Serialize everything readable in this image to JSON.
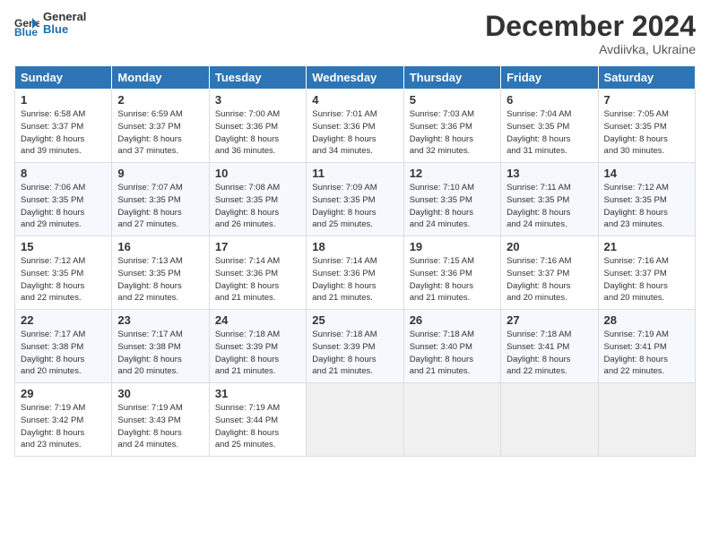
{
  "header": {
    "logo_general": "General",
    "logo_blue": "Blue",
    "month_title": "December 2024",
    "location": "Avdiivka, Ukraine"
  },
  "weekdays": [
    "Sunday",
    "Monday",
    "Tuesday",
    "Wednesday",
    "Thursday",
    "Friday",
    "Saturday"
  ],
  "weeks": [
    [
      {
        "day": "1",
        "info": "Sunrise: 6:58 AM\nSunset: 3:37 PM\nDaylight: 8 hours\nand 39 minutes."
      },
      {
        "day": "2",
        "info": "Sunrise: 6:59 AM\nSunset: 3:37 PM\nDaylight: 8 hours\nand 37 minutes."
      },
      {
        "day": "3",
        "info": "Sunrise: 7:00 AM\nSunset: 3:36 PM\nDaylight: 8 hours\nand 36 minutes."
      },
      {
        "day": "4",
        "info": "Sunrise: 7:01 AM\nSunset: 3:36 PM\nDaylight: 8 hours\nand 34 minutes."
      },
      {
        "day": "5",
        "info": "Sunrise: 7:03 AM\nSunset: 3:36 PM\nDaylight: 8 hours\nand 32 minutes."
      },
      {
        "day": "6",
        "info": "Sunrise: 7:04 AM\nSunset: 3:35 PM\nDaylight: 8 hours\nand 31 minutes."
      },
      {
        "day": "7",
        "info": "Sunrise: 7:05 AM\nSunset: 3:35 PM\nDaylight: 8 hours\nand 30 minutes."
      }
    ],
    [
      {
        "day": "8",
        "info": "Sunrise: 7:06 AM\nSunset: 3:35 PM\nDaylight: 8 hours\nand 29 minutes."
      },
      {
        "day": "9",
        "info": "Sunrise: 7:07 AM\nSunset: 3:35 PM\nDaylight: 8 hours\nand 27 minutes."
      },
      {
        "day": "10",
        "info": "Sunrise: 7:08 AM\nSunset: 3:35 PM\nDaylight: 8 hours\nand 26 minutes."
      },
      {
        "day": "11",
        "info": "Sunrise: 7:09 AM\nSunset: 3:35 PM\nDaylight: 8 hours\nand 25 minutes."
      },
      {
        "day": "12",
        "info": "Sunrise: 7:10 AM\nSunset: 3:35 PM\nDaylight: 8 hours\nand 24 minutes."
      },
      {
        "day": "13",
        "info": "Sunrise: 7:11 AM\nSunset: 3:35 PM\nDaylight: 8 hours\nand 24 minutes."
      },
      {
        "day": "14",
        "info": "Sunrise: 7:12 AM\nSunset: 3:35 PM\nDaylight: 8 hours\nand 23 minutes."
      }
    ],
    [
      {
        "day": "15",
        "info": "Sunrise: 7:12 AM\nSunset: 3:35 PM\nDaylight: 8 hours\nand 22 minutes."
      },
      {
        "day": "16",
        "info": "Sunrise: 7:13 AM\nSunset: 3:35 PM\nDaylight: 8 hours\nand 22 minutes."
      },
      {
        "day": "17",
        "info": "Sunrise: 7:14 AM\nSunset: 3:36 PM\nDaylight: 8 hours\nand 21 minutes."
      },
      {
        "day": "18",
        "info": "Sunrise: 7:14 AM\nSunset: 3:36 PM\nDaylight: 8 hours\nand 21 minutes."
      },
      {
        "day": "19",
        "info": "Sunrise: 7:15 AM\nSunset: 3:36 PM\nDaylight: 8 hours\nand 21 minutes."
      },
      {
        "day": "20",
        "info": "Sunrise: 7:16 AM\nSunset: 3:37 PM\nDaylight: 8 hours\nand 20 minutes."
      },
      {
        "day": "21",
        "info": "Sunrise: 7:16 AM\nSunset: 3:37 PM\nDaylight: 8 hours\nand 20 minutes."
      }
    ],
    [
      {
        "day": "22",
        "info": "Sunrise: 7:17 AM\nSunset: 3:38 PM\nDaylight: 8 hours\nand 20 minutes."
      },
      {
        "day": "23",
        "info": "Sunrise: 7:17 AM\nSunset: 3:38 PM\nDaylight: 8 hours\nand 20 minutes."
      },
      {
        "day": "24",
        "info": "Sunrise: 7:18 AM\nSunset: 3:39 PM\nDaylight: 8 hours\nand 21 minutes."
      },
      {
        "day": "25",
        "info": "Sunrise: 7:18 AM\nSunset: 3:39 PM\nDaylight: 8 hours\nand 21 minutes."
      },
      {
        "day": "26",
        "info": "Sunrise: 7:18 AM\nSunset: 3:40 PM\nDaylight: 8 hours\nand 21 minutes."
      },
      {
        "day": "27",
        "info": "Sunrise: 7:18 AM\nSunset: 3:41 PM\nDaylight: 8 hours\nand 22 minutes."
      },
      {
        "day": "28",
        "info": "Sunrise: 7:19 AM\nSunset: 3:41 PM\nDaylight: 8 hours\nand 22 minutes."
      }
    ],
    [
      {
        "day": "29",
        "info": "Sunrise: 7:19 AM\nSunset: 3:42 PM\nDaylight: 8 hours\nand 23 minutes."
      },
      {
        "day": "30",
        "info": "Sunrise: 7:19 AM\nSunset: 3:43 PM\nDaylight: 8 hours\nand 24 minutes."
      },
      {
        "day": "31",
        "info": "Sunrise: 7:19 AM\nSunset: 3:44 PM\nDaylight: 8 hours\nand 25 minutes."
      },
      {
        "day": "",
        "info": ""
      },
      {
        "day": "",
        "info": ""
      },
      {
        "day": "",
        "info": ""
      },
      {
        "day": "",
        "info": ""
      }
    ]
  ]
}
